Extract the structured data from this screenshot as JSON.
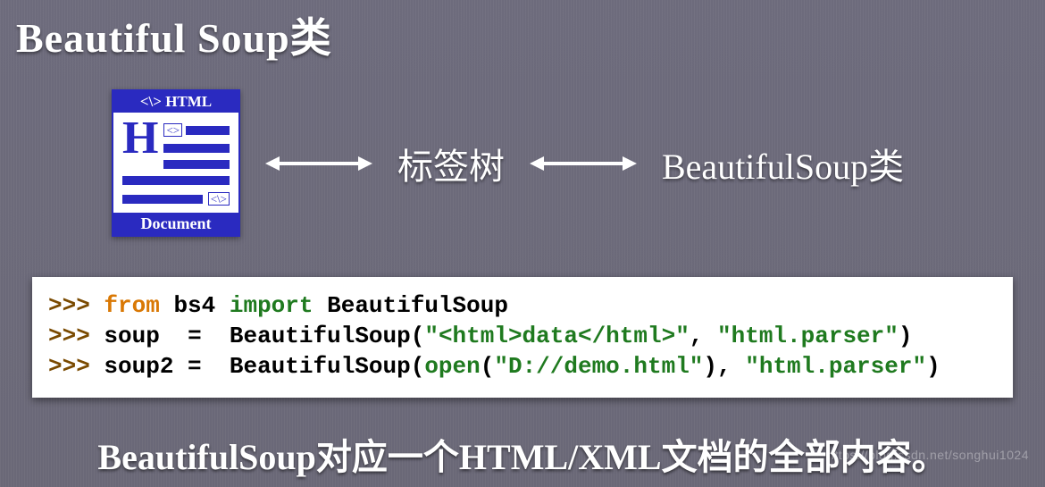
{
  "title": "Beautiful Soup类",
  "diagram": {
    "icon_header": "<\\> HTML",
    "icon_letter": "H",
    "icon_tag": "<>",
    "icon_close": "<\\>",
    "icon_footer": "Document",
    "label_middle": "标签树",
    "label_right": "BeautifulSoup类"
  },
  "code": {
    "prompt": ">>>",
    "kw_from": "from",
    "mod": "bs4",
    "kw_import": "import",
    "cls": "BeautifulSoup",
    "var1": "soup",
    "var2": "soup2",
    "eq": "=",
    "paren_open": "(",
    "paren_close": ")",
    "comma": ",",
    "str_html": "\"<html>data</html>\"",
    "str_parser": "\"html.parser\"",
    "fn_open": "open",
    "str_path": "\"D://demo.html\""
  },
  "footer": "BeautifulSoup对应一个HTML/XML文档的全部内容。",
  "watermark": "https://blog.csdn.net/songhui1024"
}
